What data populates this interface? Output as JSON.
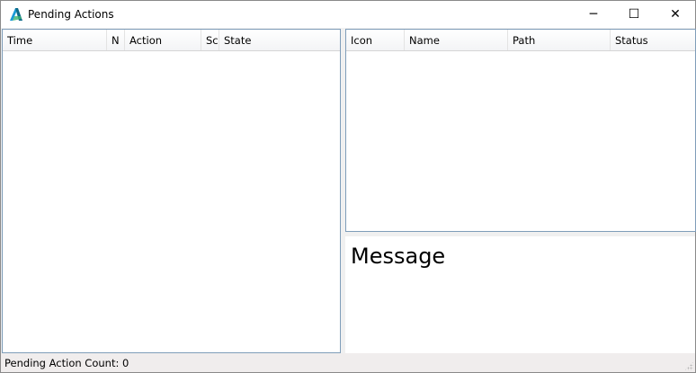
{
  "window": {
    "title": "Pending Actions",
    "minimize": "─",
    "maximize": "☐",
    "close": "✕"
  },
  "actions_list": {
    "columns": [
      "Time",
      "N",
      "Action",
      "Sc",
      "State"
    ],
    "rows": []
  },
  "items_list": {
    "columns": [
      "Icon",
      "Name",
      "Path",
      "Status"
    ],
    "rows": []
  },
  "message": {
    "label": "Message"
  },
  "status_bar": {
    "text": "Pending Action Count: 0"
  }
}
